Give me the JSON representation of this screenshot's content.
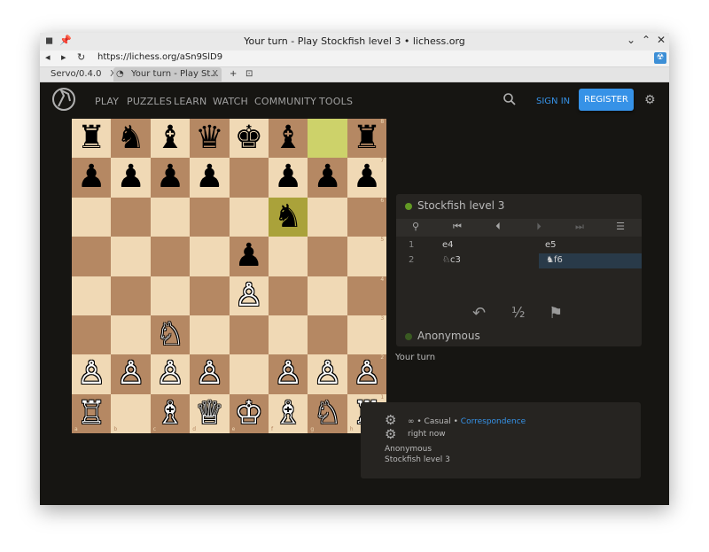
{
  "window": {
    "title": "Your turn - Play Stockfish level 3 • lichess.org",
    "controls": [
      "⌄",
      "⌃",
      "✕"
    ]
  },
  "browser": {
    "url": "https://lichess.org/aSn9SlD9",
    "tabs": [
      {
        "label": "Servo/0.4.0",
        "close": "X"
      },
      {
        "label": "Your turn - Play St...",
        "close": "X"
      }
    ],
    "new_tab": "+",
    "tab_menu": "⊡"
  },
  "site": {
    "menu": [
      "PLAY",
      "PUZZLES",
      "LEARN",
      "WATCH",
      "COMMUNITY",
      "TOOLS"
    ],
    "sign_in": "SIGN IN",
    "register": "REGISTER"
  },
  "board": {
    "ranks": [
      "8",
      "7",
      "6",
      "5",
      "4",
      "3",
      "2",
      "1"
    ],
    "files": [
      "a",
      "b",
      "c",
      "d",
      "e",
      "f",
      "g",
      "h"
    ],
    "position": [
      [
        "♜",
        "♞",
        "♝",
        "♛",
        "♚",
        "♝",
        "",
        "♜"
      ],
      [
        "♟",
        "♟",
        "♟",
        "♟",
        "",
        "♟",
        "♟",
        "♟"
      ],
      [
        "",
        "",
        "",
        "",
        "",
        "♞",
        "",
        ""
      ],
      [
        "",
        "",
        "",
        "",
        "♟",
        "",
        "",
        ""
      ],
      [
        "",
        "",
        "",
        "",
        "♙",
        "",
        "",
        ""
      ],
      [
        "",
        "",
        "♘",
        "",
        "",
        "",
        "",
        ""
      ],
      [
        "♙",
        "♙",
        "♙",
        "♙",
        "",
        "♙",
        "♙",
        "♙"
      ],
      [
        "♖",
        "",
        "♗",
        "♕",
        "♔",
        "♗",
        "♘",
        "♖"
      ]
    ],
    "colors": [
      [
        "b",
        "b",
        "b",
        "b",
        "b",
        "b",
        "",
        "b"
      ],
      [
        "b",
        "b",
        "b",
        "b",
        "",
        "b",
        "b",
        "b"
      ],
      [
        "",
        "",
        "",
        "",
        "",
        "b",
        "",
        ""
      ],
      [
        "",
        "",
        "",
        "",
        "b",
        "",
        "",
        ""
      ],
      [
        "",
        "",
        "",
        "",
        "w",
        "",
        "",
        ""
      ],
      [
        "",
        "",
        "w",
        "",
        "",
        "",
        "",
        ""
      ],
      [
        "w",
        "w",
        "w",
        "w",
        "",
        "w",
        "w",
        "w"
      ],
      [
        "w",
        "",
        "w",
        "w",
        "w",
        "w",
        "w",
        "w"
      ]
    ],
    "last_move": [
      "g8",
      "f6"
    ],
    "light_color": "#f0d9b5",
    "dark_color": "#b58863",
    "highlight_color": "#cdd26a"
  },
  "game": {
    "opponent": "Stockfish level 3",
    "player": "Anonymous",
    "status": "Your turn",
    "controls": [
      "⚲",
      "⏮",
      "⏴",
      "⏵",
      "⏭",
      "☰"
    ],
    "moves": [
      {
        "num": "1",
        "white": "e4",
        "black": "e5"
      },
      {
        "num": "2",
        "white": "♘c3",
        "black": "♞f6"
      }
    ],
    "actions": [
      "↶",
      "½",
      "⚑"
    ]
  },
  "info": {
    "clock": "∞",
    "mode": "Casual",
    "speed": "Correspondence",
    "time": "right now",
    "white_player": "Anonymous",
    "black_player": "Stockfish level 3"
  }
}
